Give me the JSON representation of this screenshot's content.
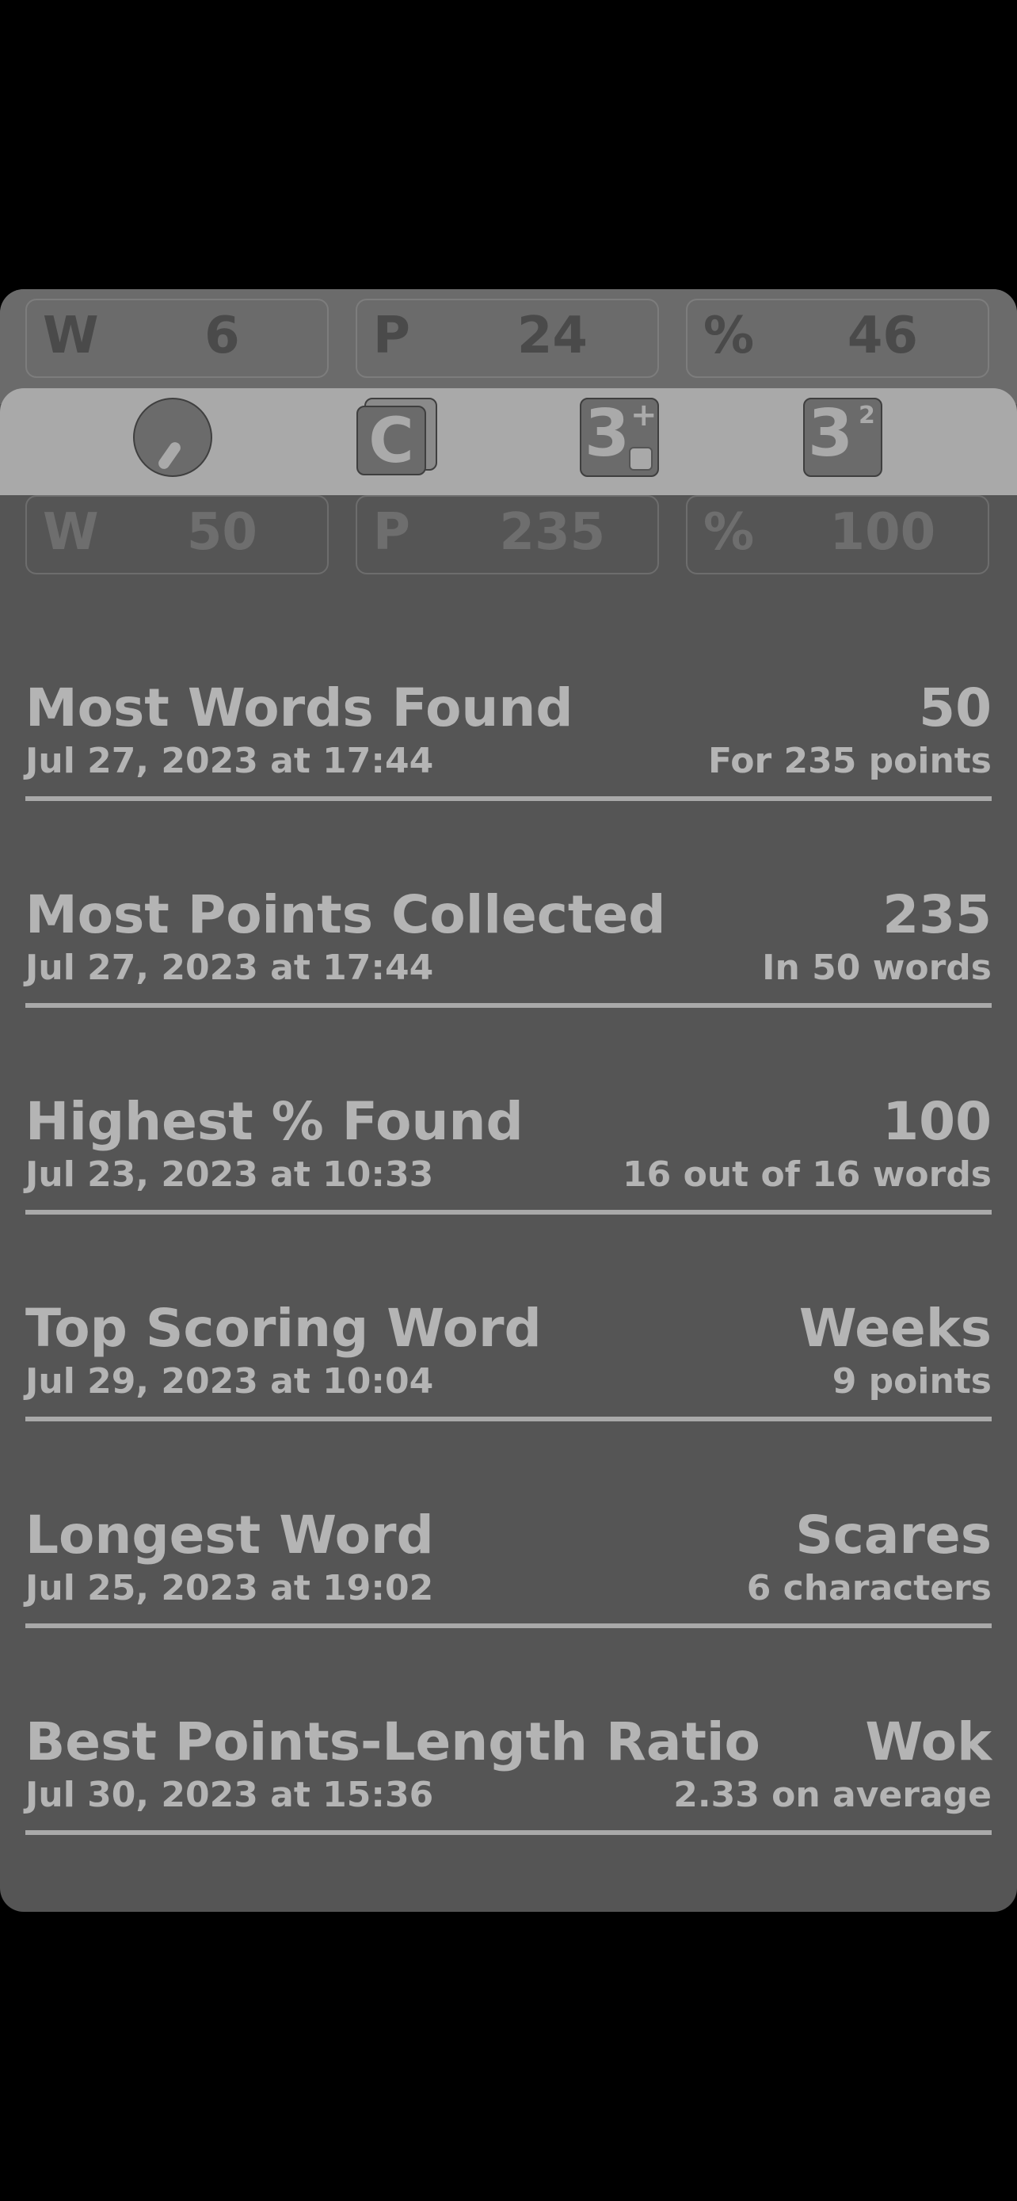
{
  "current": {
    "words": {
      "key": "W",
      "value": "6"
    },
    "points": {
      "key": "P",
      "value": "24"
    },
    "percent": {
      "key": "%",
      "value": "46"
    }
  },
  "toolbar": {
    "cards_letter": "C",
    "plus_tile": {
      "big": "3",
      "sup": "+"
    },
    "square_tile": {
      "big": "3",
      "sup": "2"
    }
  },
  "overall": {
    "words": {
      "key": "W",
      "value": "50"
    },
    "points": {
      "key": "P",
      "value": "235"
    },
    "percent": {
      "key": "%",
      "value": "100"
    }
  },
  "records": [
    {
      "title": "Most Words Found",
      "value": "50",
      "date": "Jul 27, 2023 at 17:44",
      "detail": "For 235 points"
    },
    {
      "title": "Most Points Collected",
      "value": "235",
      "date": "Jul 27, 2023 at 17:44",
      "detail": "In 50 words"
    },
    {
      "title": "Highest % Found",
      "value": "100",
      "date": "Jul 23, 2023 at 10:33",
      "detail": "16 out of 16 words"
    },
    {
      "title": "Top Scoring Word",
      "value": "Weeks",
      "date": "Jul 29, 2023 at 10:04",
      "detail": "9 points"
    },
    {
      "title": "Longest Word",
      "value": "Scares",
      "date": "Jul 25, 2023 at 19:02",
      "detail": "6 characters"
    },
    {
      "title": "Best Points-Length Ratio",
      "value": "Wok",
      "date": "Jul 30, 2023 at 15:36",
      "detail": "2.33 on average"
    }
  ]
}
